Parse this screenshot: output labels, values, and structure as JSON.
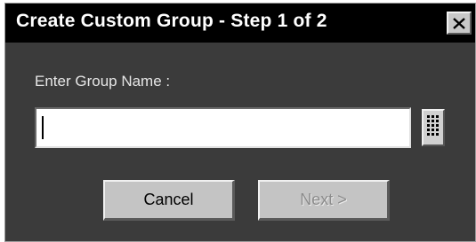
{
  "dialog": {
    "title": "Create Custom Group - Step 1 of 2",
    "close_label": "×"
  },
  "form": {
    "group_name_label": "Enter Group Name :",
    "group_name_value": "",
    "group_name_placeholder": ""
  },
  "buttons": {
    "cancel_label": "Cancel",
    "next_label": "Next >",
    "next_enabled": false
  },
  "icons": {
    "keypad": "keypad-icon",
    "close": "close-icon"
  },
  "colors": {
    "title_bar": "#000000",
    "dialog_background": "#3b3b3b",
    "button_face": "#c4c4c4",
    "disabled_text": "#8c8c8c"
  }
}
